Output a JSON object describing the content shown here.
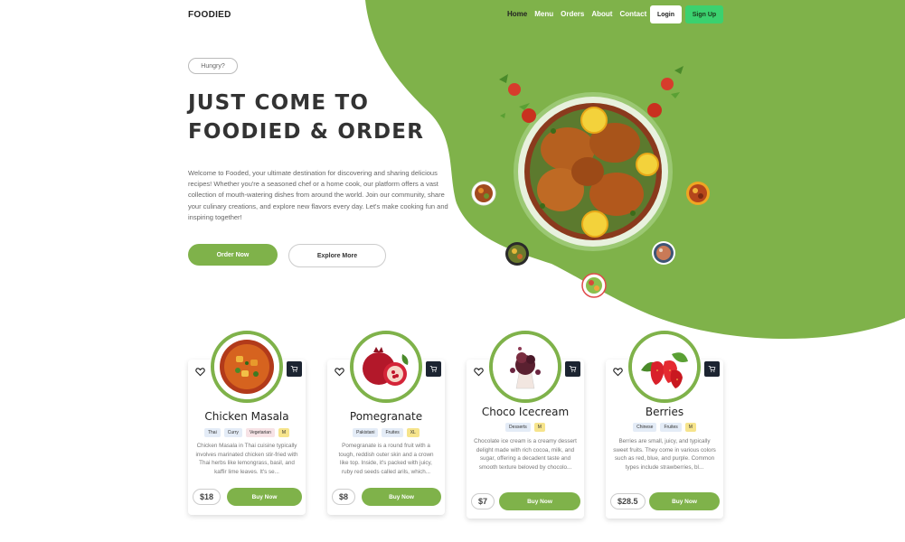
{
  "nav": {
    "brand": "FOODIED",
    "links": [
      "Home",
      "Menu",
      "Orders",
      "About",
      "Contact"
    ],
    "login": "Login",
    "signup": "Sign Up"
  },
  "hero": {
    "pill": "Hungry?",
    "headline_line1": "JUST COME TO",
    "headline_line2": "FOODIED & ORDER",
    "description": "Welcome to Fooded, your ultimate destination for discovering and sharing delicious recipes! Whether you're a seasoned chef or a home cook, our platform offers a vast collection of mouth-watering dishes from around the world. Join our community, share your culinary creations, and explore new flavors every day. Let's make cooking fun and inspiring together!",
    "order_button": "Order Now",
    "explore_button": "Explore More"
  },
  "colors": {
    "accent": "#7fb24a",
    "signup": "#3bd16f",
    "dark": "#1c2431"
  },
  "cards": [
    {
      "title": "Chicken Masala",
      "tags": [
        "Thai",
        "Curry",
        "Vegetarian",
        "M"
      ],
      "description": "Chicken Masala in Thai cuisine typically involves marinated chicken stir-fried with Thai herbs like lemongrass, basil, and kaffir lime leaves. It's se...",
      "price": "$18",
      "buy": "Buy Now"
    },
    {
      "title": "Pomegranate",
      "tags": [
        "Pakistani",
        "Fruites",
        "XL"
      ],
      "description": "Pomegranate is a round fruit with a tough, reddish outer skin and a crown like top. Inside, it's packed with juicy, ruby red seeds called arils, which...",
      "price": "$8",
      "buy": "Buy Now"
    },
    {
      "title": "Choco Icecream",
      "tags": [
        "Desserts",
        "M"
      ],
      "description": "Chocolate ice cream is a creamy dessert delight made with rich cocoa, milk, and sugar, offering a decadent taste and smooth texture beloved by chocolo...",
      "price": "$7",
      "buy": "Buy Now"
    },
    {
      "title": "Berries",
      "tags": [
        "Chinese",
        "Fruites",
        "M"
      ],
      "description": "Berries are small, juicy, and typically sweet fruits. They come in various colors such as red, blue, and purple. Common types include strawberries, bl...",
      "price": "$28.5",
      "buy": "Buy Now"
    }
  ]
}
